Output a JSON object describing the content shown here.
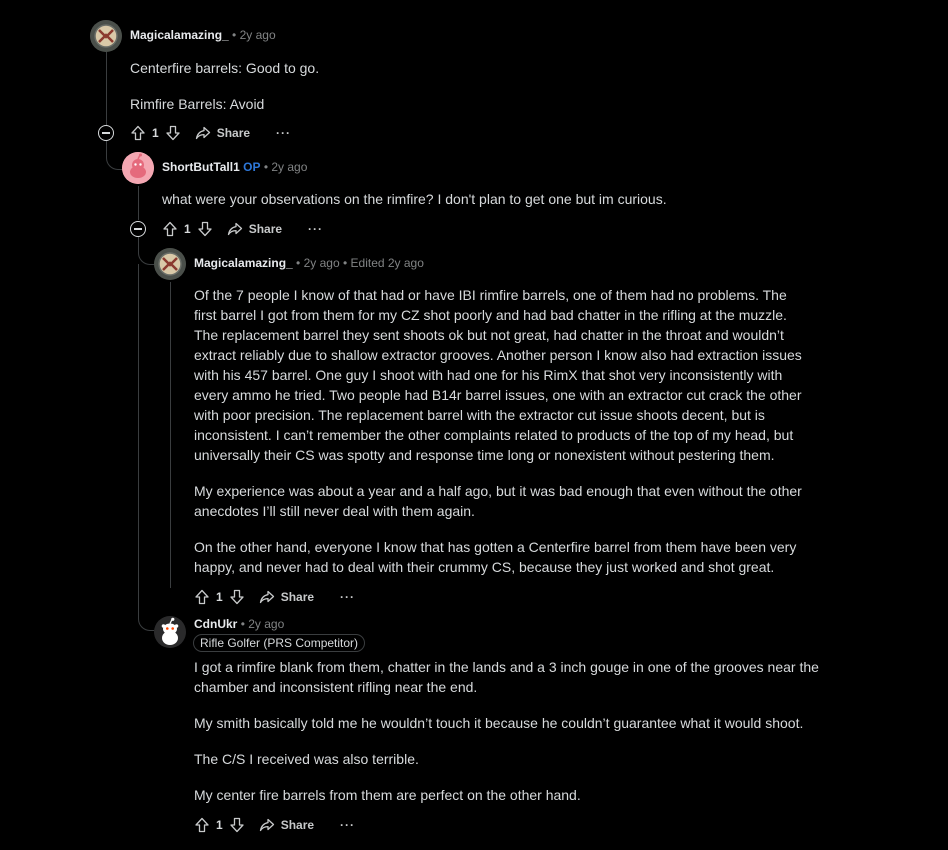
{
  "comments": [
    {
      "author": "Magicalamazing_",
      "time": "2y ago",
      "paragraphs": [
        "Centerfire barrels: Good to go.",
        "Rimfire Barrels: Avoid"
      ],
      "score": "1",
      "share_label": "Share",
      "more_label": "···"
    },
    {
      "author": "ShortButTall1",
      "op_label": "OP",
      "time": "2y ago",
      "paragraphs": [
        "what were your observations on the rimfire? I don't plan to get one but im curious."
      ],
      "score": "1",
      "share_label": "Share",
      "more_label": "···"
    },
    {
      "author": "Magicalamazing_",
      "time": "2y ago",
      "edited": "Edited 2y ago",
      "paragraphs": [
        "Of the 7 people I know of that had or have IBI rimfire barrels, one of them had no problems. The first barrel I got from them for my CZ shot poorly and had bad chatter in the rifling at the muzzle. The replacement barrel they sent shoots ok but not great, had chatter in the throat and wouldn’t extract reliably due to shallow extractor grooves. Another person I know also had extraction issues with his 457 barrel. One guy I shoot with had one for his RimX that shot very inconsistently with every ammo he tried. Two people had B14r barrel issues, one with an extractor cut crack the other with poor precision. The replacement barrel with the extractor cut issue shoots decent, but is inconsistent. I can’t remember the other complaints related to products of the top of my head, but universally their CS was spotty and response time long or nonexistent without pestering them.",
        "My experience was about a year and a half ago, but it was bad enough that even without the other anecdotes I’ll still never deal with them again.",
        "On the other hand, everyone I know that has gotten a Centerfire barrel from them have been very happy, and never had to deal with their crummy CS, because they just worked and shot great."
      ],
      "score": "1",
      "share_label": "Share",
      "more_label": "···"
    },
    {
      "author": "CdnUkr",
      "time": "2y ago",
      "flair": "Rifle Golfer (PRS Competitor)",
      "paragraphs": [
        "I got a rimfire blank from them, chatter in the lands and a 3 inch gouge in one of the grooves near the chamber and inconsistent rifling near the end.",
        "My smith basically told me he wouldn’t touch it because he couldn’t guarantee what it would shoot.",
        "The C/S I received was also terrible.",
        "My center fire barrels from them are perfect on the other hand."
      ],
      "score": "1",
      "share_label": "Share",
      "more_label": "···"
    }
  ],
  "separator": "•",
  "colors": {
    "background": "#000000",
    "text": "#d7dadc",
    "meta": "#818384",
    "op": "#2e78d9",
    "thread_line": "#3a3d3f"
  },
  "icons": [
    "upvote-icon",
    "downvote-icon",
    "share-icon",
    "collapse-icon",
    "avatar-icon"
  ]
}
